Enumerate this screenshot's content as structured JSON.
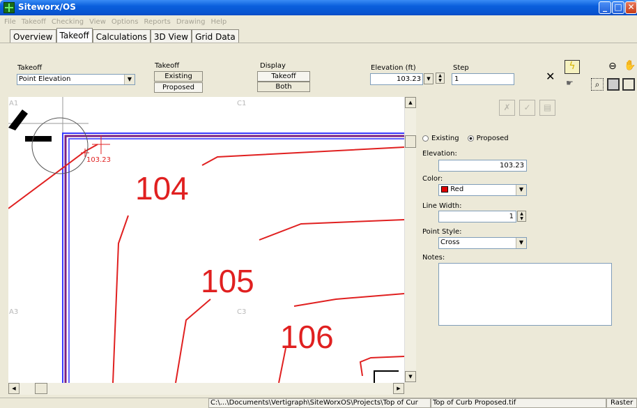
{
  "window": {
    "title": "Siteworx/OS",
    "min": "_",
    "max": "□",
    "close": "✕"
  },
  "menu": [
    "File",
    "Takeoff",
    "Checking",
    "View",
    "Options",
    "Reports",
    "Drawing",
    "Help"
  ],
  "tabs": [
    "Overview",
    "Takeoff",
    "Calculations",
    "3D View",
    "Grid Data"
  ],
  "toolbar": {
    "takeoff_label": "Takeoff",
    "takeoff_value": "Point Elevation",
    "takeoff2_label": "Takeoff",
    "takeoff2_options": [
      "Existing",
      "Proposed"
    ],
    "display_label": "Display",
    "display_options": [
      "Takeoff",
      "Both"
    ],
    "elevation_label": "Elevation (ft)",
    "elevation_value": "103.23",
    "step_label": "Step",
    "step_value": "1"
  },
  "canvas": {
    "grid_labels": {
      "a1": "A1",
      "c1": "C1",
      "a3": "A3",
      "c3": "C3"
    },
    "contours": [
      "104",
      "105",
      "106"
    ],
    "point_label": "103.23"
  },
  "panel": {
    "radio_existing": "Existing",
    "radio_proposed": "Proposed",
    "elevation_label": "Elevation:",
    "elevation_value": "103.23",
    "color_label": "Color:",
    "color_value": "Red",
    "color_swatch": "#e00000",
    "linewidth_label": "Line Width:",
    "linewidth_value": "1",
    "pointstyle_label": "Point Style:",
    "pointstyle_value": "Cross",
    "notes_label": "Notes:",
    "notes_value": ""
  },
  "status": {
    "path": "C:\\...\\Documents\\Vertigraph\\SiteWorxOS\\Projects\\Top of Cur",
    "file": "Top of Curb Proposed.tif",
    "mode": "Raster"
  }
}
